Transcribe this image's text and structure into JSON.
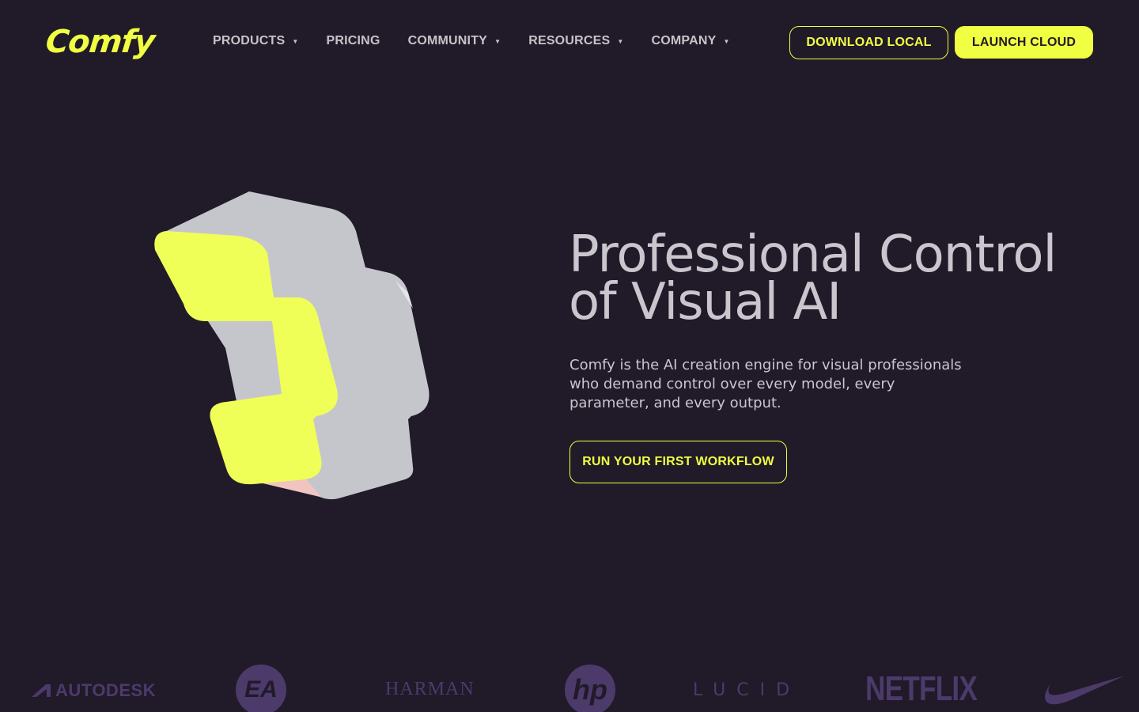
{
  "header": {
    "logo": "Comfy",
    "nav": [
      {
        "label": "PRODUCTS",
        "dropdown": true
      },
      {
        "label": "PRICING",
        "dropdown": false
      },
      {
        "label": "COMMUNITY",
        "dropdown": true
      },
      {
        "label": "RESOURCES",
        "dropdown": true
      },
      {
        "label": "COMPANY",
        "dropdown": true
      }
    ],
    "download_label": "DOWNLOAD LOCAL",
    "launch_label": "LAUNCH CLOUD"
  },
  "hero": {
    "title_line1": "Professional Control",
    "title_line2": "of Visual AI",
    "subtitle": "Comfy is the AI creation engine for visual professionals who demand control over every model, every parameter, and every output.",
    "cta_label": "RUN YOUR FIRST WORKFLOW"
  },
  "logos": {
    "autodesk": "AUTODESK",
    "ea": "EA",
    "harman": "HARMAN",
    "hp": "hp",
    "lucid": "LUCID",
    "netflix": "NETFLIX"
  },
  "colors": {
    "background": "#211a29",
    "accent": "#f0ff41",
    "text": "#c9c6cd",
    "logo_muted": "#4c3a6b"
  }
}
